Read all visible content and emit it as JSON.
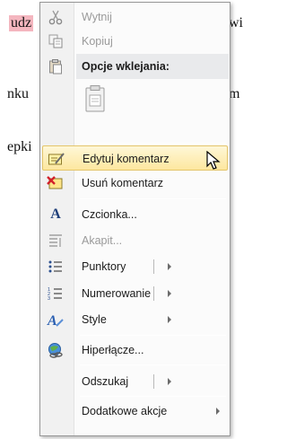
{
  "document": {
    "fragments": [
      "udz",
      "wi",
      "nku",
      "m",
      "epki"
    ]
  },
  "menu": {
    "items": [
      {
        "name": "cut",
        "label": "Wytnij",
        "icon": "scissors-icon",
        "disabled": true
      },
      {
        "name": "copy",
        "label": "Kopiuj",
        "icon": "copy-icon",
        "disabled": true
      },
      {
        "name": "edit-comment",
        "label": "Edytuj komentarz",
        "icon": "edit-comment-icon",
        "highlighted": true
      },
      {
        "name": "delete-comment",
        "label": "Usuń komentarz",
        "icon": "delete-comment-icon"
      },
      {
        "name": "font",
        "label": "Czcionka...",
        "icon": "font-icon"
      },
      {
        "name": "paragraph",
        "label": "Akapit...",
        "icon": "paragraph-icon",
        "disabled": true
      },
      {
        "name": "bullets",
        "label": "Punktory",
        "icon": "bullets-icon",
        "submenu": true,
        "split": true
      },
      {
        "name": "numbering",
        "label": "Numerowanie",
        "icon": "numbering-icon",
        "submenu": true,
        "split": true
      },
      {
        "name": "styles",
        "label": "Style",
        "icon": "styles-icon",
        "submenu": true
      },
      {
        "name": "hyperlink",
        "label": "Hiperłącze...",
        "icon": "hyperlink-icon"
      },
      {
        "name": "lookup",
        "label": "Odszukaj",
        "submenu": true,
        "split": true
      },
      {
        "name": "additional-actions",
        "label": "Dodatkowe akcje",
        "submenu": true
      }
    ],
    "paste_options_header": "Opcje wklejania:",
    "paste_icon": "paste-keep-text-icon"
  },
  "colors": {
    "highlight_bg": "#fde79f",
    "highlight_border": "#e4c56a",
    "comment_highlight": "#f4b6bf",
    "disabled_text": "#9a9a9a"
  }
}
